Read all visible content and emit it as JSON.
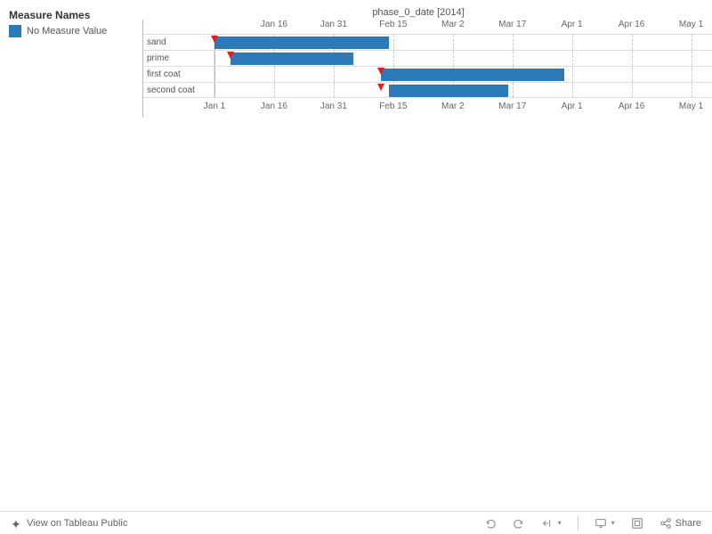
{
  "legend": {
    "title": "Measure Names",
    "item": "No Measure Value"
  },
  "chart_data": {
    "type": "bar",
    "title": "phase_0_date [2014]",
    "categories": [
      "sand",
      "prime",
      "first coat",
      "second coat"
    ],
    "series": [
      {
        "name": "sand",
        "start": "2014-01-01",
        "end": "2014-02-14",
        "marker": "2014-01-01"
      },
      {
        "name": "prime",
        "start": "2014-01-05",
        "end": "2014-02-05",
        "marker": "2014-01-05"
      },
      {
        "name": "first coat",
        "start": "2014-02-12",
        "end": "2014-03-30",
        "marker": "2014-02-12"
      },
      {
        "name": "second coat",
        "start": "2014-02-14",
        "end": "2014-03-16",
        "marker": "2014-02-12"
      }
    ],
    "xticks": [
      "Jan 1",
      "Jan 16",
      "Jan 31",
      "Feb 15",
      "Mar 2",
      "Mar 17",
      "Apr 1",
      "Apr 16",
      "May 1"
    ],
    "xrange_days": 121
  },
  "toolbar": {
    "view_label": "View on Tableau Public",
    "share_label": "Share"
  }
}
